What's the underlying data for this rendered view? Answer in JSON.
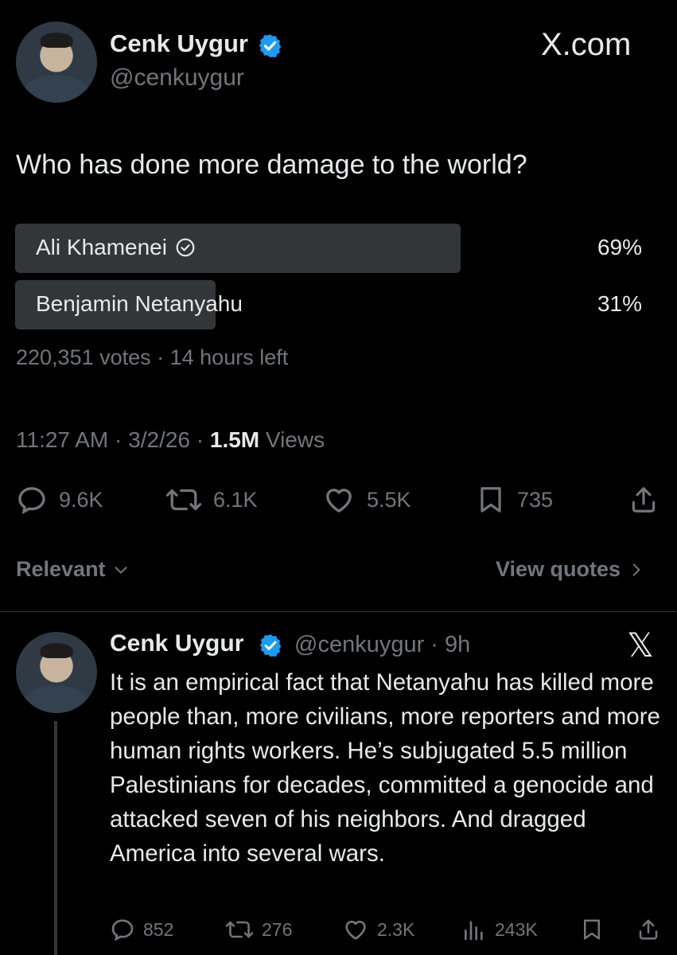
{
  "post": {
    "author_name": "Cenk Uygur",
    "author_handle": "@cenkuygur",
    "watermark": "X.com",
    "question": "Who has done more damage to the world?",
    "poll": {
      "options": [
        {
          "label": "Ali Khamenei",
          "percent_text": "69%",
          "share": 0.69,
          "winner": true
        },
        {
          "label": "Benjamin Netanyahu",
          "percent_text": "31%",
          "share": 0.31,
          "winner": false
        }
      ],
      "meta": "220,351 votes · 14 hours left"
    },
    "time": "11:27 AM",
    "date": "3/2/26",
    "views_count": "1.5M",
    "views_label": "Views",
    "actions": {
      "replies": "9.6K",
      "reposts": "6.1K",
      "likes": "5.5K",
      "bookmarks": "735"
    }
  },
  "controls": {
    "sort_label": "Relevant",
    "view_quotes_label": "View quotes"
  },
  "reply": {
    "author_name": "Cenk Uygur",
    "author_handle": "@cenkuygur",
    "age": "9h",
    "brand_glyph": "𝕏",
    "text": "It is an empirical fact that Netanyahu has killed more people than, more civilians, more reporters and more human rights workers. He’s subjugated 5.5 million Palestinians for decades, committed a genocide and attacked seven of his neighbors. And dragged America into several wars.",
    "actions": {
      "replies": "852",
      "reposts": "276",
      "likes": "2.3K",
      "views": "243K"
    }
  },
  "colors": {
    "background": "#000000",
    "text": "#e7e9ea",
    "muted": "#71767b",
    "poll_bar": "#333639",
    "verified": "#1d9bf0"
  }
}
